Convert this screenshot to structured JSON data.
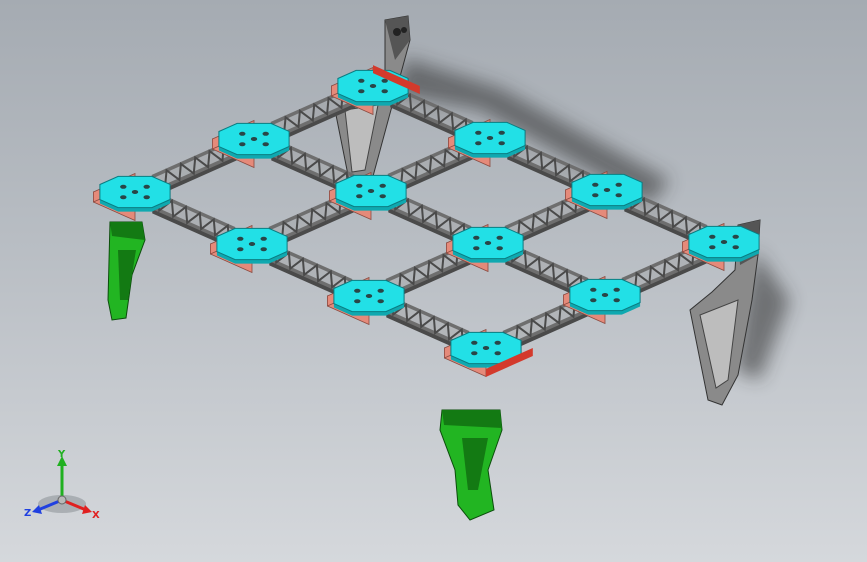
{
  "view": {
    "background_top": "#a5abb2",
    "background_bottom": "#d5d8dc"
  },
  "model": {
    "truss_color": "#6e6e6e",
    "truss_dark": "#4a4a4a",
    "truss_light": "#9a9a9a",
    "plate_color": "#22e0e6",
    "plate_dark": "#0fa9b0",
    "pad_color": "#e58a7a",
    "accent_red": "#d33a2c",
    "leg_front_color": "#22b522",
    "leg_front_dark": "#137a13",
    "leg_back_color": "#8a8a8a",
    "leg_back_dark": "#555555"
  },
  "triad": {
    "x_label": "X",
    "y_label": "Y",
    "z_label": "Z",
    "x_color": "#e02020",
    "y_color": "#20b020",
    "z_color": "#2040e0"
  }
}
